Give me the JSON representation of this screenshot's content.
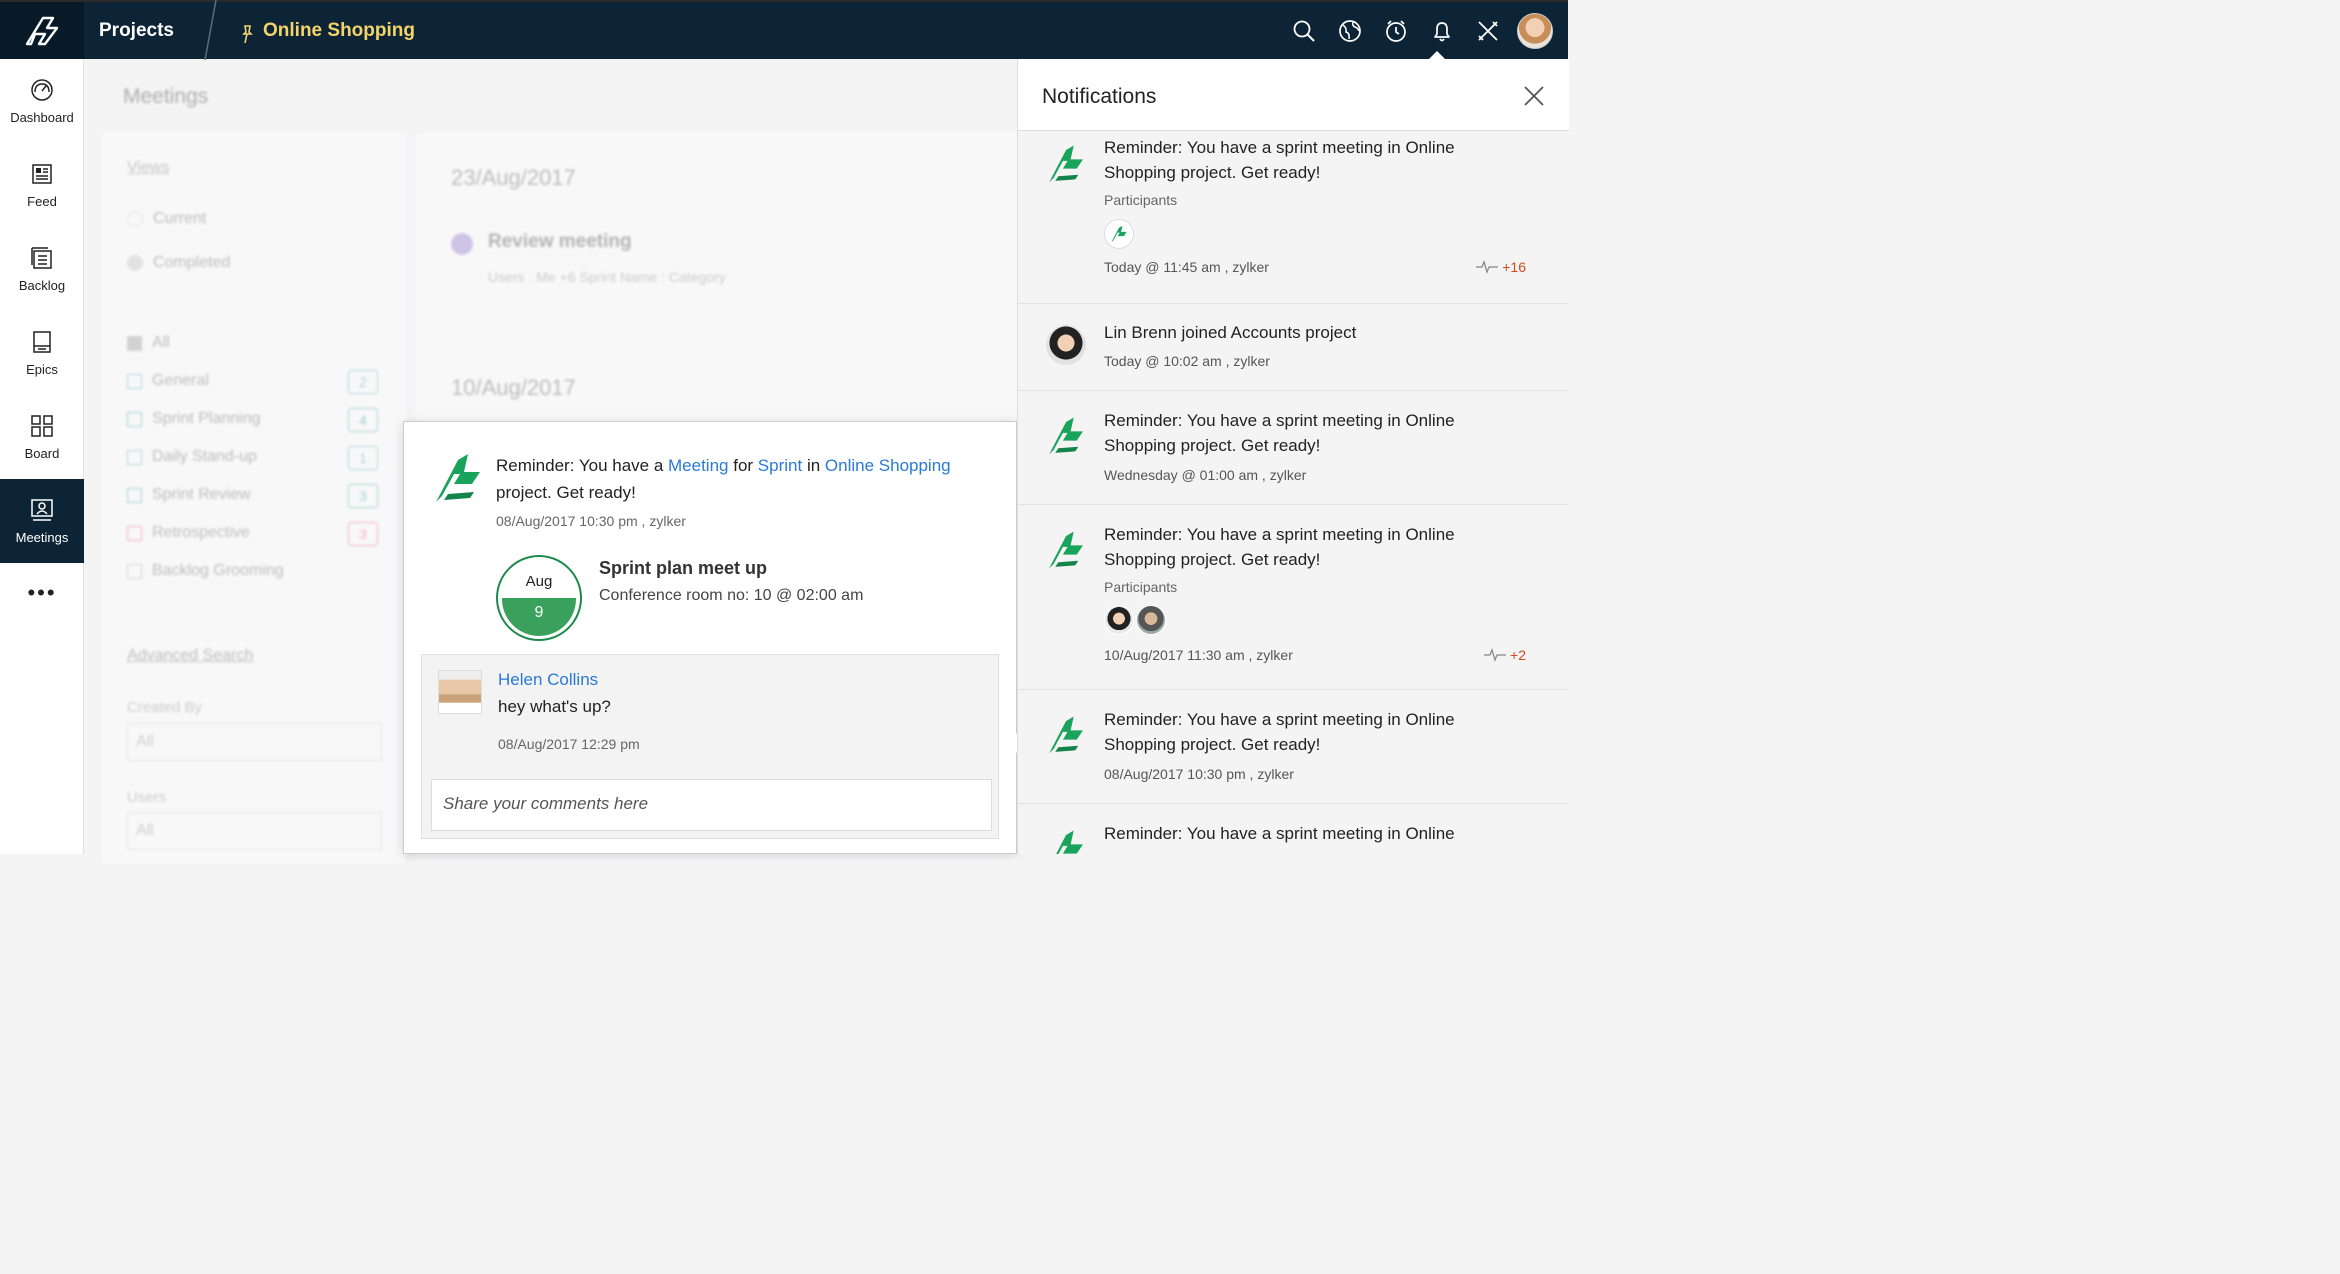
{
  "topbar": {
    "section": "Projects",
    "project_name": "Online Shopping",
    "icons": [
      "search-icon",
      "globe-icon",
      "timer-icon",
      "bell-icon",
      "tools-icon",
      "avatar"
    ]
  },
  "sidebar": {
    "items": [
      {
        "label": "Dashboard",
        "icon": "dashboard-icon"
      },
      {
        "label": "Feed",
        "icon": "feed-icon"
      },
      {
        "label": "Backlog",
        "icon": "backlog-icon"
      },
      {
        "label": "Epics",
        "icon": "epics-icon"
      },
      {
        "label": "Board",
        "icon": "board-icon"
      },
      {
        "label": "Meetings",
        "icon": "meetings-icon",
        "active": true
      }
    ],
    "more": "•••"
  },
  "background": {
    "title": "Meetings",
    "views_label": "Views",
    "views": [
      "Current",
      "Completed"
    ],
    "types": [
      {
        "label": "All",
        "count": ""
      },
      {
        "label": "General",
        "count": "2"
      },
      {
        "label": "Sprint Planning",
        "count": "4"
      },
      {
        "label": "Daily Stand-up",
        "count": "1"
      },
      {
        "label": "Sprint Review",
        "count": "3"
      },
      {
        "label": "Retrospective",
        "count": "3"
      },
      {
        "label": "Backlog Grooming",
        "count": ""
      }
    ],
    "advanced_search": "Advanced Search",
    "created_by_label": "Created By",
    "created_by_value": "All",
    "users_label": "Users",
    "users_value": "All",
    "date1": "23/Aug/2017",
    "meeting_name": "Review meeting",
    "meeting_sub": "Users : Me  +6     Sprint Name : Category",
    "date2": "10/Aug/2017"
  },
  "popup": {
    "text_1": "Reminder: You have a ",
    "link_meeting": "Meeting",
    "text_2": " for ",
    "link_sprint": "Sprint",
    "text_3": " in ",
    "link_project": "Online Shopping",
    "text_4": "project. Get ready!",
    "meta": "08/Aug/2017 10:30 pm   ,   zylker",
    "cal_month": "Aug",
    "cal_day": "9",
    "event_title": "Sprint plan meet up",
    "event_sub": "Conference room no: 10 @ 02:00 am",
    "comment": {
      "author": "Helen Collins",
      "text": "hey what's up?",
      "time": "08/Aug/2017 12:29 pm"
    },
    "comment_placeholder": "Share your comments here"
  },
  "notifications": {
    "title": "Notifications",
    "items": [
      {
        "text": "Reminder: You have a sprint meeting in Online Shopping project. Get ready!",
        "participants_label": "Participants",
        "time": "Today @ 11:45 am , zylker",
        "extra": "+16"
      },
      {
        "text": "Lin Brenn joined Accounts project",
        "time": "Today @ 10:02 am , zylker"
      },
      {
        "text": "Reminder: You have a sprint meeting in Online Shopping project. Get ready!",
        "time": "Wednesday @ 01:00 am , zylker"
      },
      {
        "text": "Reminder: You have a sprint meeting in Online Shopping project. Get ready!",
        "participants_label": "Participants",
        "time": "10/Aug/2017 11:30 am , zylker",
        "extra": "+2"
      },
      {
        "text": "Reminder: You have a sprint meeting in Online Shopping project. Get ready!",
        "time": "08/Aug/2017 10:30 pm , zylker"
      },
      {
        "text": "Reminder: You have a sprint meeting in Online"
      }
    ]
  },
  "colors": {
    "topbar": "#0c2436",
    "accent_yellow": "#f3d46b",
    "brand_green": "#1aa35a",
    "link_blue": "#2a7ad6",
    "count_orange": "#d0491b"
  }
}
